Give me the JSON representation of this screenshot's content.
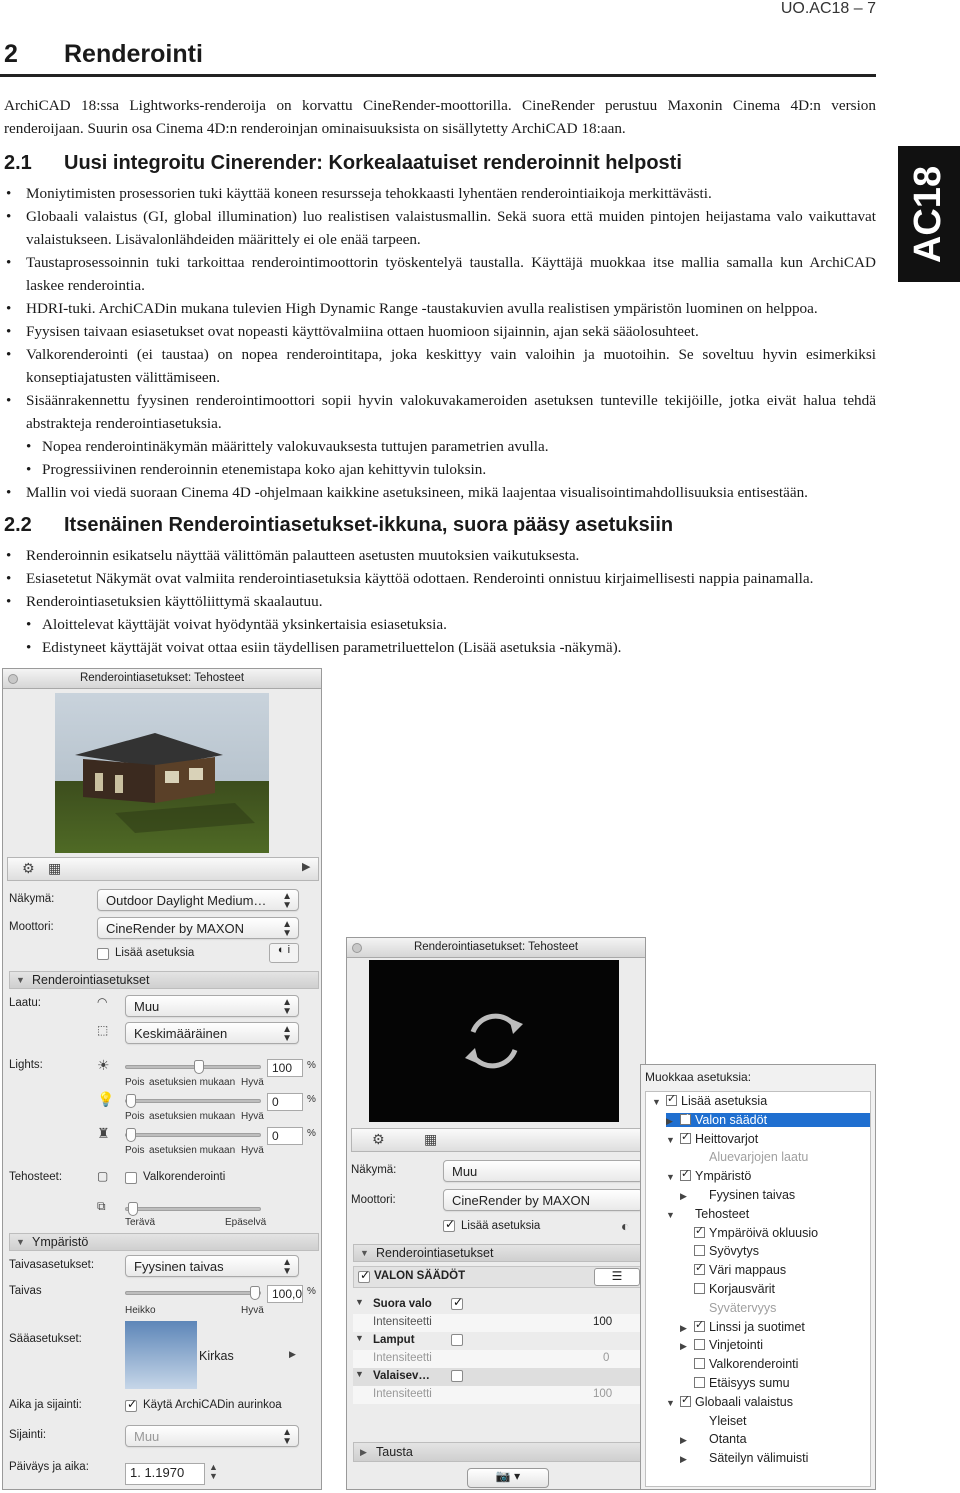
{
  "header": {
    "page_ref": "UO.AC18 – 7"
  },
  "side_tab": "AC18",
  "section": {
    "number": "2",
    "title": "Renderointi"
  },
  "intro": "ArchiCAD 18:ssa Lightworks-renderoija on korvattu CineRender-moottorilla. CineRender perustuu Maxonin Cinema 4D:n version renderoijaan. Suurin osa Cinema 4D:n renderoinjan ominaisuuksista on sisällytetty ArchiCAD 18:aan.",
  "s21": {
    "number": "2.1",
    "title": "Uusi integroitu Cinerender: Korkealaatuiset renderoinnit helposti",
    "items": [
      "Moniytimisten prosessorien tuki käyttää koneen resursseja tehokkaasti lyhentäen renderointiaikoja merkittävästi.",
      "Globaali valaistus (GI, global illumination) luo realistisen valaistusmallin. Sekä suora että muiden pintojen heijastama valo vaikuttavat valaistukseen. Lisävalonlähdeiden määrittely ei ole enää tarpeen.",
      "Taustaprosessoinnin tuki tarkoittaa renderointimoottorin työskentelyä taustalla. Käyttäjä muokkaa itse mallia samalla kun ArchiCAD laskee renderointia.",
      "HDRI-tuki. ArchiCADin mukana tulevien High Dynamic Range -taustakuvien avulla realistisen ympäristön luominen on helppoa.",
      "Fyysisen taivaan esiasetukset ovat nopeasti käyttövalmiina ottaen huomioon sijainnin, ajan sekä sääolosuhteet.",
      "Valkorenderointi (ei taustaa) on nopea renderointitapa, joka keskittyy vain valoihin ja muotoihin. Se soveltuu hyvin esimerkiksi konseptiajatusten välittämiseen.",
      "Sisäänrakennettu fyysinen renderointimoottori sopii hyvin valokuvakameroiden asetuksen tunteville tekijöille, jotka eivät halua tehdä abstrakteja renderointiasetuksia."
    ],
    "subitems": [
      "Nopea renderointinäkymän määrittely valokuvauksesta tuttujen parametrien avulla.",
      "Progressiivinen renderoinnin etenemistapa koko ajan kehittyvin tuloksin."
    ],
    "last_item": "Mallin voi viedä suoraan Cinema 4D -ohjelmaan kaikkine asetuksineen, mikä laajentaa visualisointimahdollisuuksia entisestään."
  },
  "s22": {
    "number": "2.2",
    "title": "Itsenäinen Renderointiasetukset-ikkuna, suora pääsy asetuksiin",
    "items": [
      "Renderoinnin esikatselu näyttää välittömän palautteen asetusten muutoksien vaikutuksesta.",
      "Esiasetetut Näkymät ovat valmiita renderointiasetuksia käyttöä odottaen. Renderointi onnistuu kirjaimellisesti nappia painamalla.",
      "Renderointiasetuksien käyttöliittymä skaalautuu."
    ],
    "subitems": [
      "Aloittelevat käyttäjät voivat hyödyntää yksinkertaisia esiasetuksia.",
      "Edistyneet käyttäjät voivat ottaa esiin täydellisen parametriluettelon (Lisää asetuksia -näkymä)."
    ]
  },
  "win1": {
    "title": "Renderointiasetukset: Tehosteet",
    "nakyma_label": "Näkymä:",
    "nakyma_value": "Outdoor Daylight Medium…",
    "moottori_label": "Moottori:",
    "moottori_value": "CineRender by MAXON",
    "lisaa": "Lisää asetuksia",
    "sec_render": "Renderointiasetukset",
    "laatu_label": "Laatu:",
    "laatu1": "Muu",
    "laatu2": "Keskimääräinen",
    "lights_label": "Lights:",
    "lights": [
      {
        "value": "100",
        "pois": "Pois",
        "mid": "asetuksien mukaan",
        "hyva": "Hyvä",
        "level": 0.55
      },
      {
        "value": "0",
        "pois": "Pois",
        "mid": "asetuksien mukaan",
        "hyva": "Hyvä",
        "level": 0.0
      },
      {
        "value": "0",
        "pois": "Pois",
        "mid": "asetuksien mukaan",
        "hyva": "Hyvä",
        "level": 0.0
      }
    ],
    "pct": "%",
    "tehosteet_label": "Tehosteet:",
    "valko": "Valkorenderointi",
    "terava": "Terävä",
    "epaselva": "Epäselvä",
    "sec_ymp": "Ympäristö",
    "taivas_label": "Taivasasetukset:",
    "taivas_value": "Fyysinen taivas",
    "taivas2_label": "Taivas",
    "taivas2_value": "100,0",
    "heikko": "Heikko",
    "hyva": "Hyvä",
    "saa_label": "Sääasetukset:",
    "kirkas": "Kirkas",
    "aika_label": "Aika ja sijainti:",
    "kayta": "Käytä ArchiCADin aurinkoa",
    "sijainti_label": "Sijainti:",
    "sijainti_value": "Muu",
    "paivays_label": "Päiväys ja aika:",
    "paivays_value": "1. 1.1970"
  },
  "win2": {
    "title": "Renderointiasetukset: Tehosteet",
    "nakyma_label": "Näkymä:",
    "nakyma_value": "Muu",
    "moottori_label": "Moottori:",
    "moottori_value": "CineRender by MAXON",
    "lisaa": "Lisää asetuksia",
    "sec_render": "Renderointiasetukset",
    "valon": "VALON SÄÄDÖT",
    "rows": [
      {
        "label": "Suora valo",
        "checked": true
      },
      {
        "label": "Intensiteetti",
        "value": "100"
      },
      {
        "label": "Lamput",
        "checked": false
      },
      {
        "label": "Intensiteetti",
        "value": "0"
      },
      {
        "label": "Valaisev…",
        "checked": false
      },
      {
        "label": "Intensiteetti",
        "value": "100"
      }
    ],
    "tausta": "Tausta"
  },
  "win3": {
    "title": "Muokkaa asetuksia:",
    "tree": [
      {
        "label": "Lisää asetuksia",
        "level": 0,
        "tri": "down",
        "cb": "on"
      },
      {
        "label": "Valon säädöt",
        "level": 1,
        "tri": "right",
        "cb": "on",
        "sel": true
      },
      {
        "label": "Heittovarjot",
        "level": 1,
        "tri": "down",
        "cb": "on"
      },
      {
        "label": "Aluevarjojen laatu",
        "level": 2,
        "tri": "",
        "cb": "",
        "dim": true
      },
      {
        "label": "Ympäristö",
        "level": 1,
        "tri": "down",
        "cb": "on"
      },
      {
        "label": "Fyysinen taivas",
        "level": 2,
        "tri": "right",
        "cb": ""
      },
      {
        "label": "Tehosteet",
        "level": 1,
        "tri": "down",
        "cb": ""
      },
      {
        "label": "Ympäröivä okluusio",
        "level": 2,
        "tri": "",
        "cb": "on"
      },
      {
        "label": "Syövytys",
        "level": 2,
        "tri": "",
        "cb": "off"
      },
      {
        "label": "Väri mappaus",
        "level": 2,
        "tri": "",
        "cb": "on"
      },
      {
        "label": "Korjausvärit",
        "level": 2,
        "tri": "",
        "cb": "off"
      },
      {
        "label": "Syvätervyys",
        "level": 2,
        "tri": "",
        "cb": "",
        "dim": true
      },
      {
        "label": "Linssi ja suotimet",
        "level": 2,
        "tri": "right",
        "cb": "on"
      },
      {
        "label": "Vinjetointi",
        "level": 2,
        "tri": "right",
        "cb": "off"
      },
      {
        "label": "Valkorenderointi",
        "level": 2,
        "tri": "",
        "cb": "off"
      },
      {
        "label": "Etäisyys sumu",
        "level": 2,
        "tri": "",
        "cb": "off"
      },
      {
        "label": "Globaali valaistus",
        "level": 1,
        "tri": "down",
        "cb": "on"
      },
      {
        "label": "Yleiset",
        "level": 2,
        "tri": "",
        "cb": ""
      },
      {
        "label": "Otanta",
        "level": 2,
        "tri": "right",
        "cb": ""
      },
      {
        "label": "Säteilyn välimuisti",
        "level": 2,
        "tri": "right",
        "cb": ""
      }
    ]
  }
}
